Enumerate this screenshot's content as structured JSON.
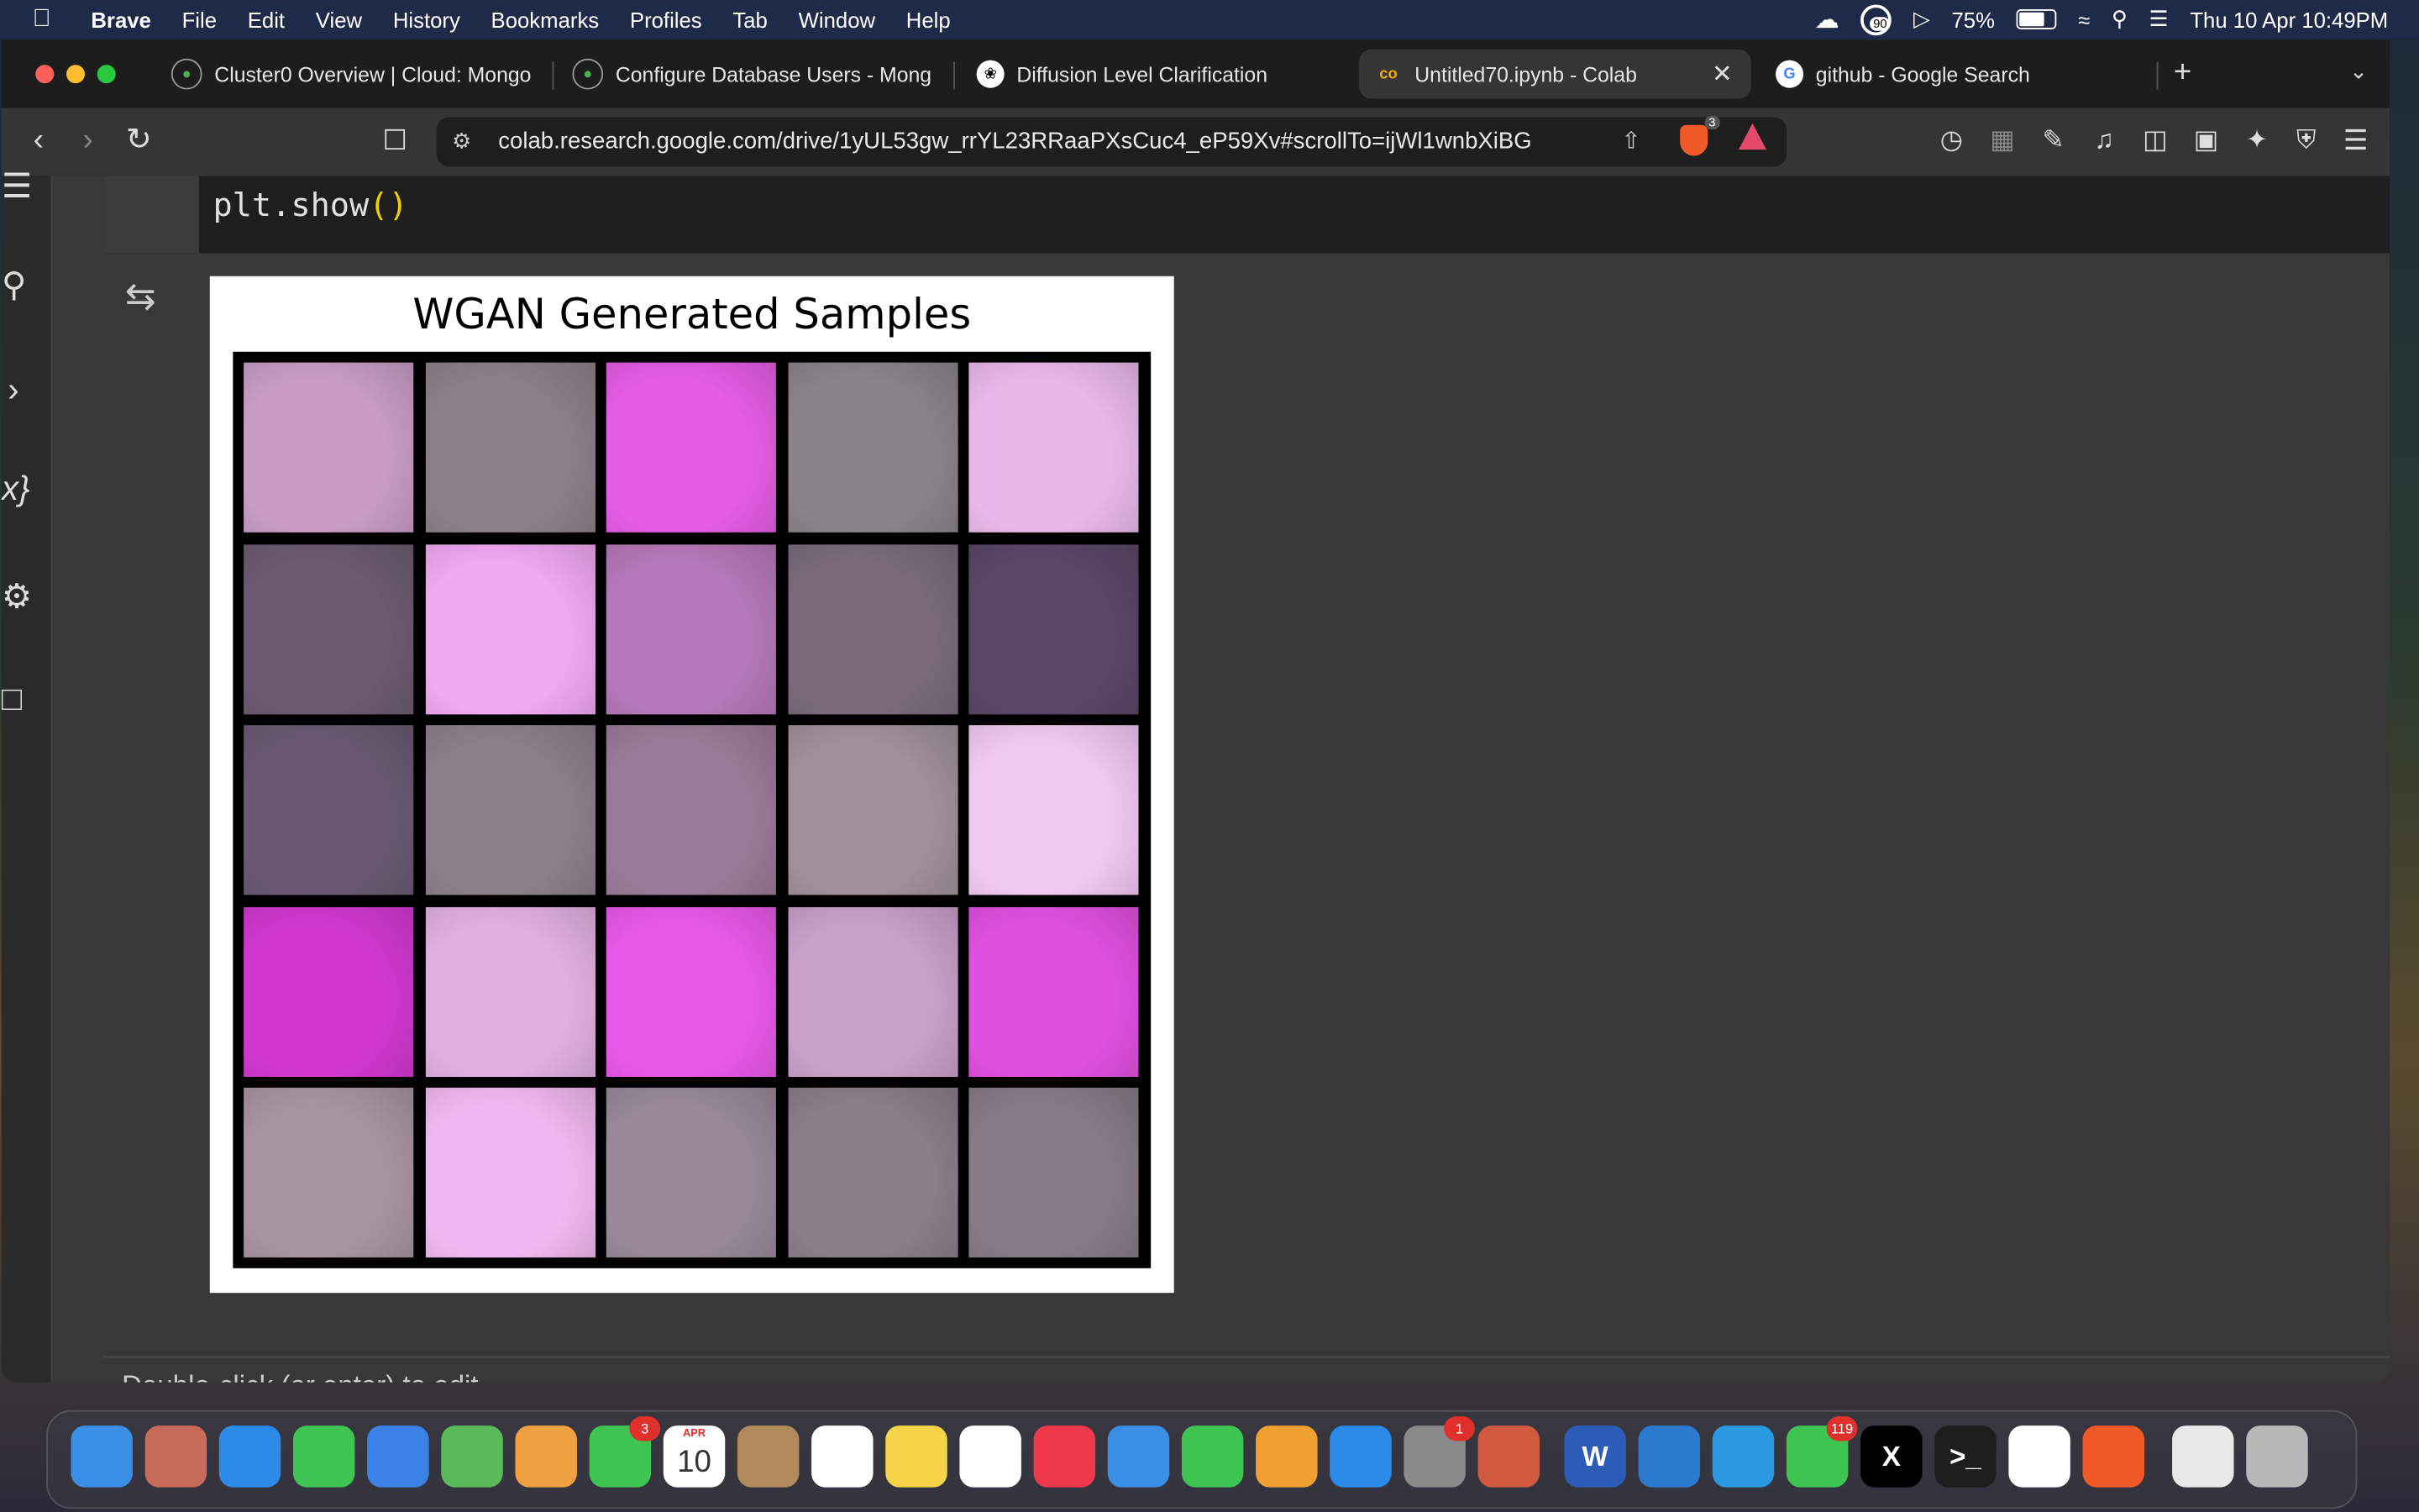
{
  "menubar": {
    "app": "Brave",
    "items": [
      "File",
      "Edit",
      "View",
      "History",
      "Bookmarks",
      "Profiles",
      "Tab",
      "Window",
      "Help"
    ],
    "battery": "75%",
    "clock": "Thu 10 Apr  10:49PM",
    "badge_count": "90"
  },
  "tabs": [
    {
      "title": "Cluster0 Overview | Cloud: Mongo",
      "icon": "mongodb-leaf-icon"
    },
    {
      "title": "Configure Database Users - Mong",
      "icon": "mongodb-leaf-icon"
    },
    {
      "title": "Diffusion Level Clarification",
      "icon": "openai-icon"
    },
    {
      "title": "Untitled70.ipynb - Colab",
      "icon": "colab-icon",
      "active": true
    },
    {
      "title": "github - Google Search",
      "icon": "google-icon"
    }
  ],
  "address": {
    "url": "colab.research.google.com/drive/1yUL53gw_rrYL23RRaaPXsCuc4_eP59Xv#scrollTo=ijWl1wnbXiBG",
    "shield_count": "3"
  },
  "code": {
    "line": "plt.show",
    "paren_open": "(",
    "paren_close": ")"
  },
  "figure": {
    "title": "WGAN Generated Samples",
    "tiles": [
      [
        "#c89cc4",
        "#8c8088",
        "#e45ce4",
        "#8a8488",
        "#e8b8e8"
      ],
      [
        "#6c5a70",
        "#f0a8f0",
        "#b478b8",
        "#7a6a7c",
        "#5a4666"
      ],
      [
        "#6a5872",
        "#8a808a",
        "#9a7a98",
        "#a09098",
        "#f0c8f0"
      ],
      [
        "#d038d0",
        "#e0b0e0",
        "#e858e8",
        "#c8a0c8",
        "#e050e0"
      ],
      [
        "#a8949e",
        "#f0b8f0",
        "#988898",
        "#8a7e88",
        "#867a86"
      ]
    ]
  },
  "status_text": "Double-click (or enter) to edit",
  "dock": [
    {
      "name": "finder",
      "color": "#3a8ee6"
    },
    {
      "name": "launchpad",
      "color": "#c86a5a"
    },
    {
      "name": "safari",
      "color": "#2c8ae8"
    },
    {
      "name": "messages",
      "color": "#3ec451"
    },
    {
      "name": "mail",
      "color": "#3b82e6"
    },
    {
      "name": "maps",
      "color": "#5aba5a"
    },
    {
      "name": "photos",
      "color": "#f0a040"
    },
    {
      "name": "facetime",
      "color": "#3ec451",
      "badge": "3"
    },
    {
      "name": "calendar",
      "color": "#ffffff",
      "label": "10",
      "sublabel": "APR"
    },
    {
      "name": "contacts",
      "color": "#b08a5a"
    },
    {
      "name": "reminders",
      "color": "#ffffff"
    },
    {
      "name": "notes",
      "color": "#f5d44a"
    },
    {
      "name": "freeform",
      "color": "#ffffff"
    },
    {
      "name": "music",
      "color": "#f0394a"
    },
    {
      "name": "keynote",
      "color": "#3a8ee6"
    },
    {
      "name": "numbers",
      "color": "#3ec451"
    },
    {
      "name": "pages",
      "color": "#f0a030"
    },
    {
      "name": "app-store",
      "color": "#2c8ae8"
    },
    {
      "name": "system-settings",
      "color": "#8a8a8a",
      "badge": "1"
    },
    {
      "name": "iphone-mirroring",
      "color": "#d05a40"
    },
    {
      "name": "word",
      "color": "#2b5cb8",
      "label": "W"
    },
    {
      "name": "vscode",
      "color": "#2a7ad0"
    },
    {
      "name": "telegram",
      "color": "#2a9ae0"
    },
    {
      "name": "whatsapp",
      "color": "#3ec451",
      "badge": "119"
    },
    {
      "name": "x",
      "color": "#000000",
      "label": "X"
    },
    {
      "name": "terminal",
      "color": "#1e1e1e",
      "label": ">_"
    },
    {
      "name": "mongodb-compass",
      "color": "#ffffff"
    },
    {
      "name": "brave",
      "color": "#f05a28"
    },
    {
      "name": "downloads",
      "color": "#e8e8e8"
    },
    {
      "name": "trash",
      "color": "#b8b8b8"
    }
  ]
}
